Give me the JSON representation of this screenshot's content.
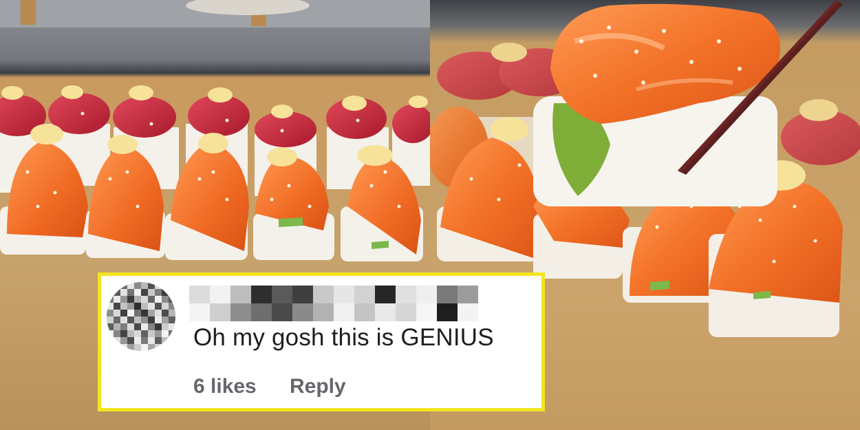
{
  "left_photo": {
    "subject": "rows of salmon and tuna sushi bites topped with mayo and sesame on a wooden board"
  },
  "right_photo": {
    "subject": "chopsticks lifting a salmon avocado sushi bite"
  },
  "comment": {
    "username": "",
    "text": "Oh my gosh this is GENIUS",
    "likes": "6 likes",
    "reply_label": "Reply"
  },
  "colors": {
    "frame": "#f2e51f",
    "text": "#1c1e21",
    "meta": "#65676b",
    "salmon": "#f0772f",
    "tuna": "#c8263a",
    "rice": "#f4f1ea",
    "board": "#c8a670"
  }
}
